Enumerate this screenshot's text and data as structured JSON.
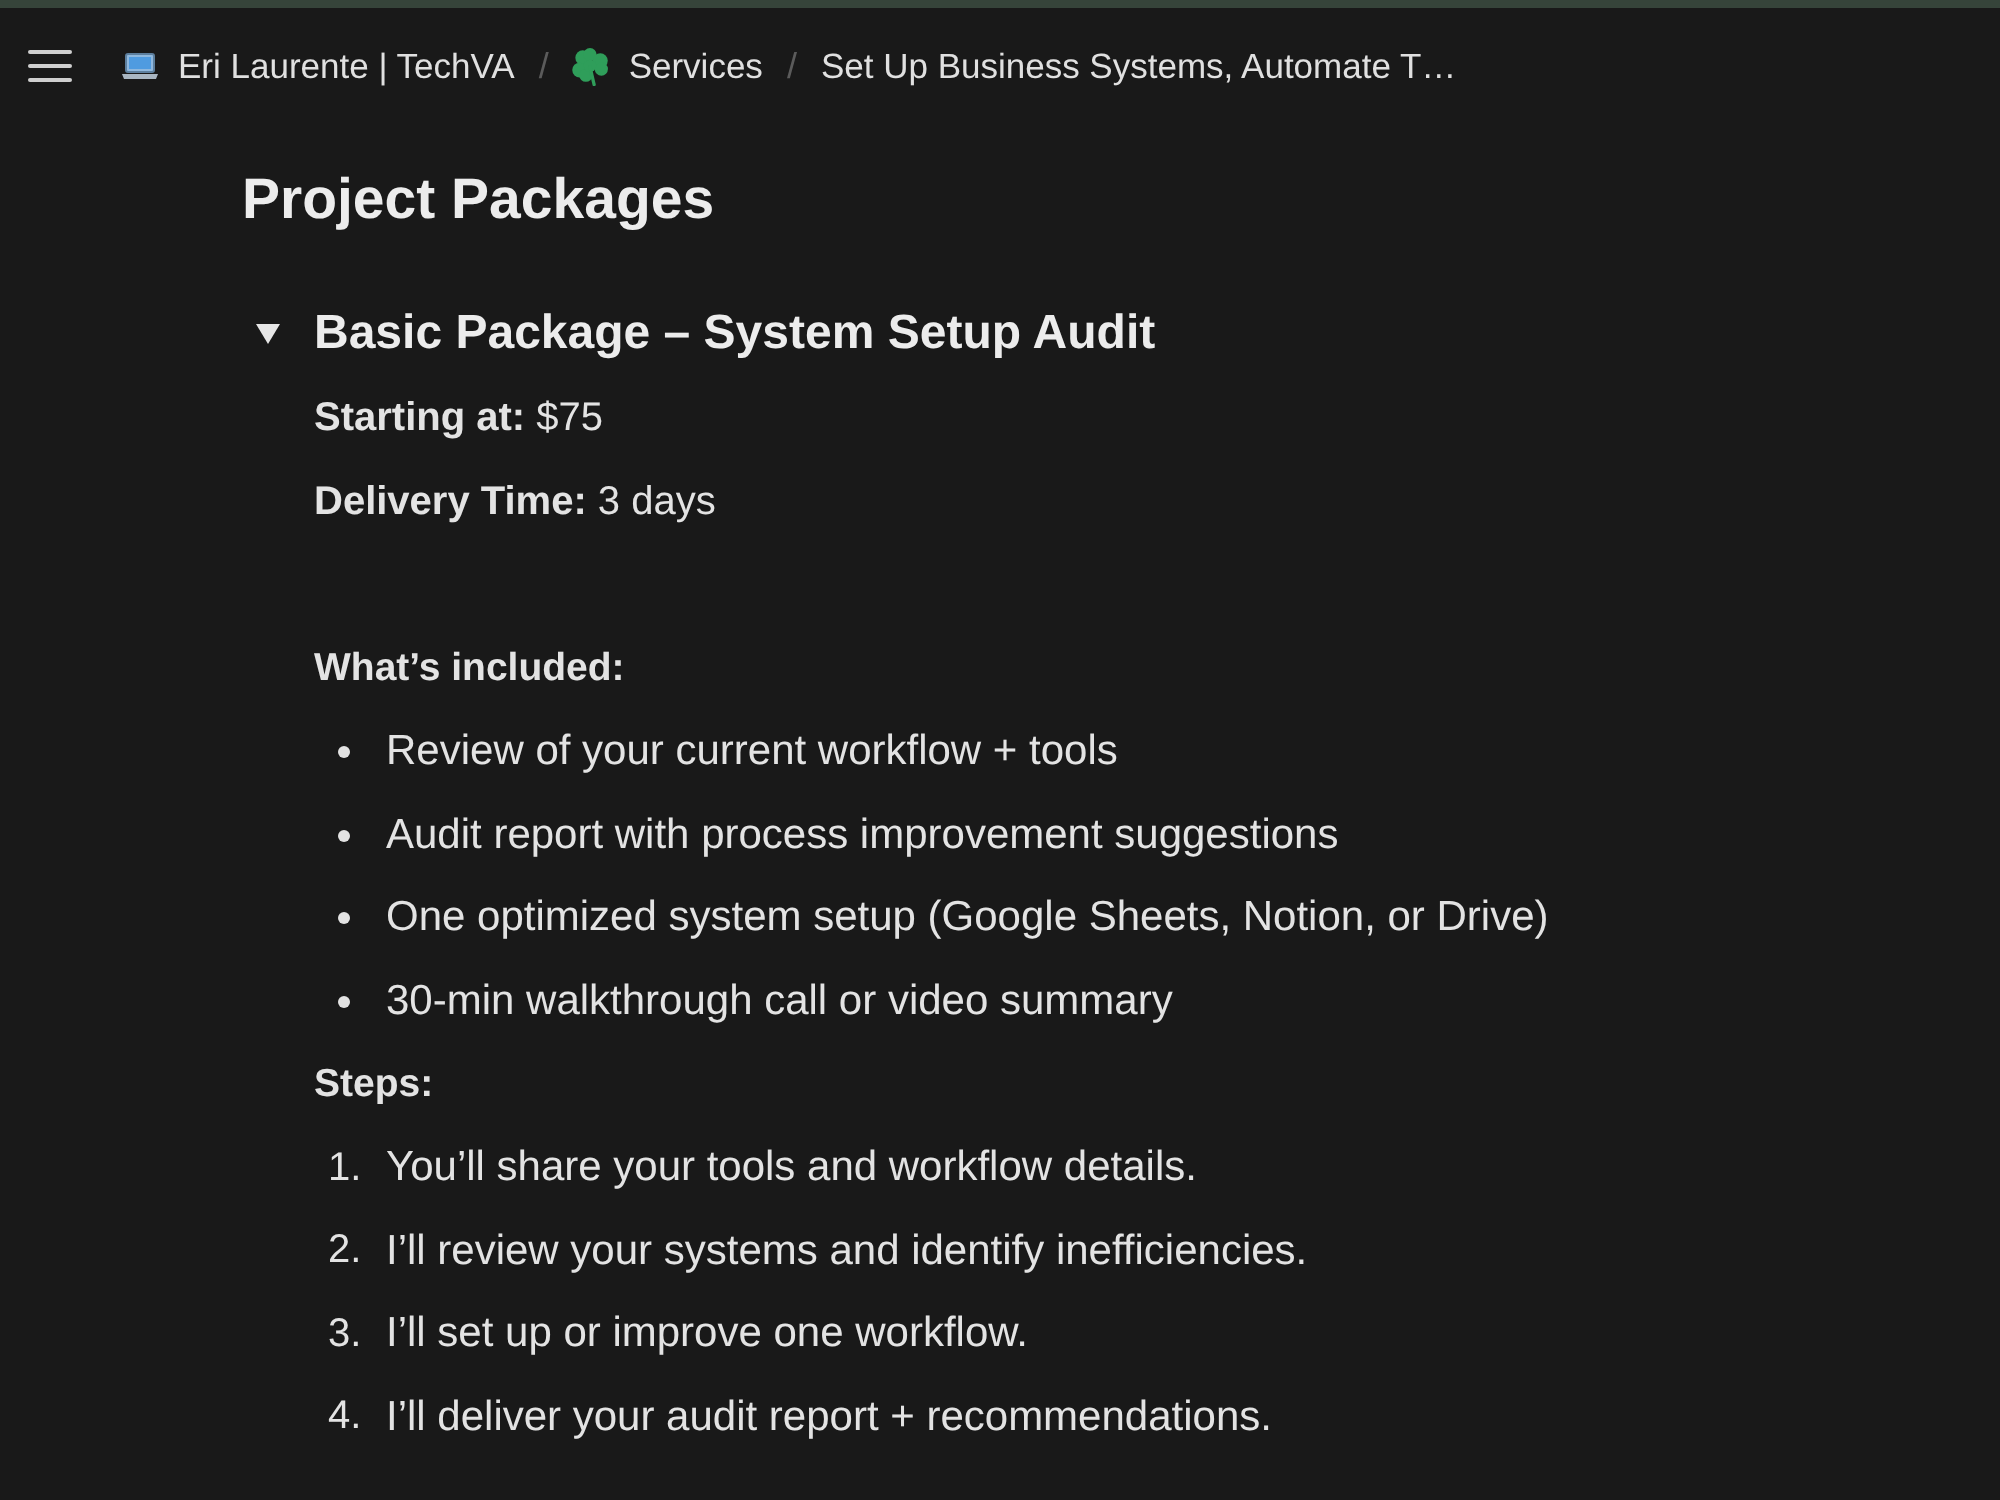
{
  "top_bar": {
    "separator": "/",
    "breadcrumbs": [
      {
        "kind": "workspace",
        "label": "Eri Laurente | TechVA"
      },
      {
        "kind": "page",
        "label": "Services"
      },
      {
        "kind": "plain",
        "label": "Set Up Business Systems, Automate T…"
      }
    ]
  },
  "page": {
    "title": "Project Packages",
    "toggle": {
      "title": "Basic Package – System Setup Audit",
      "expanded": true,
      "blocks": [
        {
          "kind": "paragraph",
          "text": "**Starting at:** $75"
        },
        {
          "kind": "paragraph",
          "text": "**Delivery Time:** 3 days"
        },
        {
          "kind": "empty"
        },
        {
          "kind": "label",
          "text": "What’s included:"
        },
        {
          "kind": "bullets",
          "items": [
            "Review of your current workflow + tools",
            "Audit report with process improvement suggestions",
            "One optimized system setup (Google Sheets, Notion, or Drive)",
            "30-min walkthrough call or video summary"
          ]
        },
        {
          "kind": "label",
          "text": "Steps:"
        },
        {
          "kind": "numbered",
          "items": [
            {
              "number": "1.",
              "text": "You’ll share your tools and workflow details."
            },
            {
              "number": "2.",
              "text": "I’ll review your systems and identify inefficiencies."
            },
            {
              "number": "3.",
              "text": "I’ll set up or improve one workflow."
            },
            {
              "number": "4.",
              "text": "I’ll deliver your audit report + recommendations."
            }
          ]
        }
      ]
    }
  }
}
